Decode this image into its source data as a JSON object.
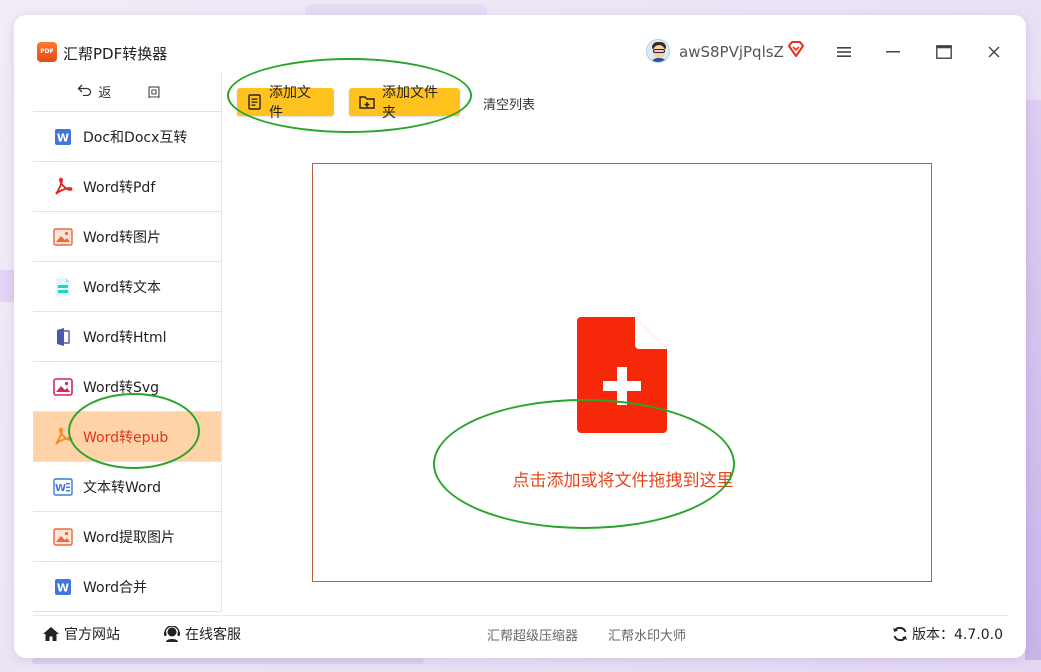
{
  "app": {
    "title": "汇帮PDF转换器",
    "logo_text": "PDF",
    "username": "awS8PVjPqlsZ"
  },
  "sidebar": {
    "back_label": "返 回",
    "items": [
      {
        "label": "Doc和Docx互转",
        "icon": "word-icon"
      },
      {
        "label": "Word转Pdf",
        "icon": "pdf-icon"
      },
      {
        "label": "Word转图片",
        "icon": "image-icon"
      },
      {
        "label": "Word转文本",
        "icon": "text-icon"
      },
      {
        "label": "Word转Html",
        "icon": "html-icon"
      },
      {
        "label": "Word转Svg",
        "icon": "svg-icon"
      },
      {
        "label": "Word转epub",
        "icon": "epub-icon",
        "active": true
      },
      {
        "label": "文本转Word",
        "icon": "text-to-word-icon"
      },
      {
        "label": "Word提取图片",
        "icon": "image-icon"
      },
      {
        "label": "Word合并",
        "icon": "word-icon"
      }
    ]
  },
  "toolbar": {
    "add_file": "添加文件",
    "add_folder": "添加文件夹",
    "clear_list": "清空列表"
  },
  "dropzone": {
    "hint": "点击添加或将文件拖拽到这里"
  },
  "statusbar": {
    "website": "官方网站",
    "support": "在线客服",
    "compressor": "汇帮超级压缩器",
    "watermark": "汇帮水印大师",
    "version": "版本：4.7.0.0"
  },
  "colors": {
    "accent_yellow": "#ffc21f",
    "active_bg": "#fdd3a7",
    "active_text": "#e4331c",
    "drop_icon": "#f5280a",
    "annotation": "#2aa52a"
  }
}
